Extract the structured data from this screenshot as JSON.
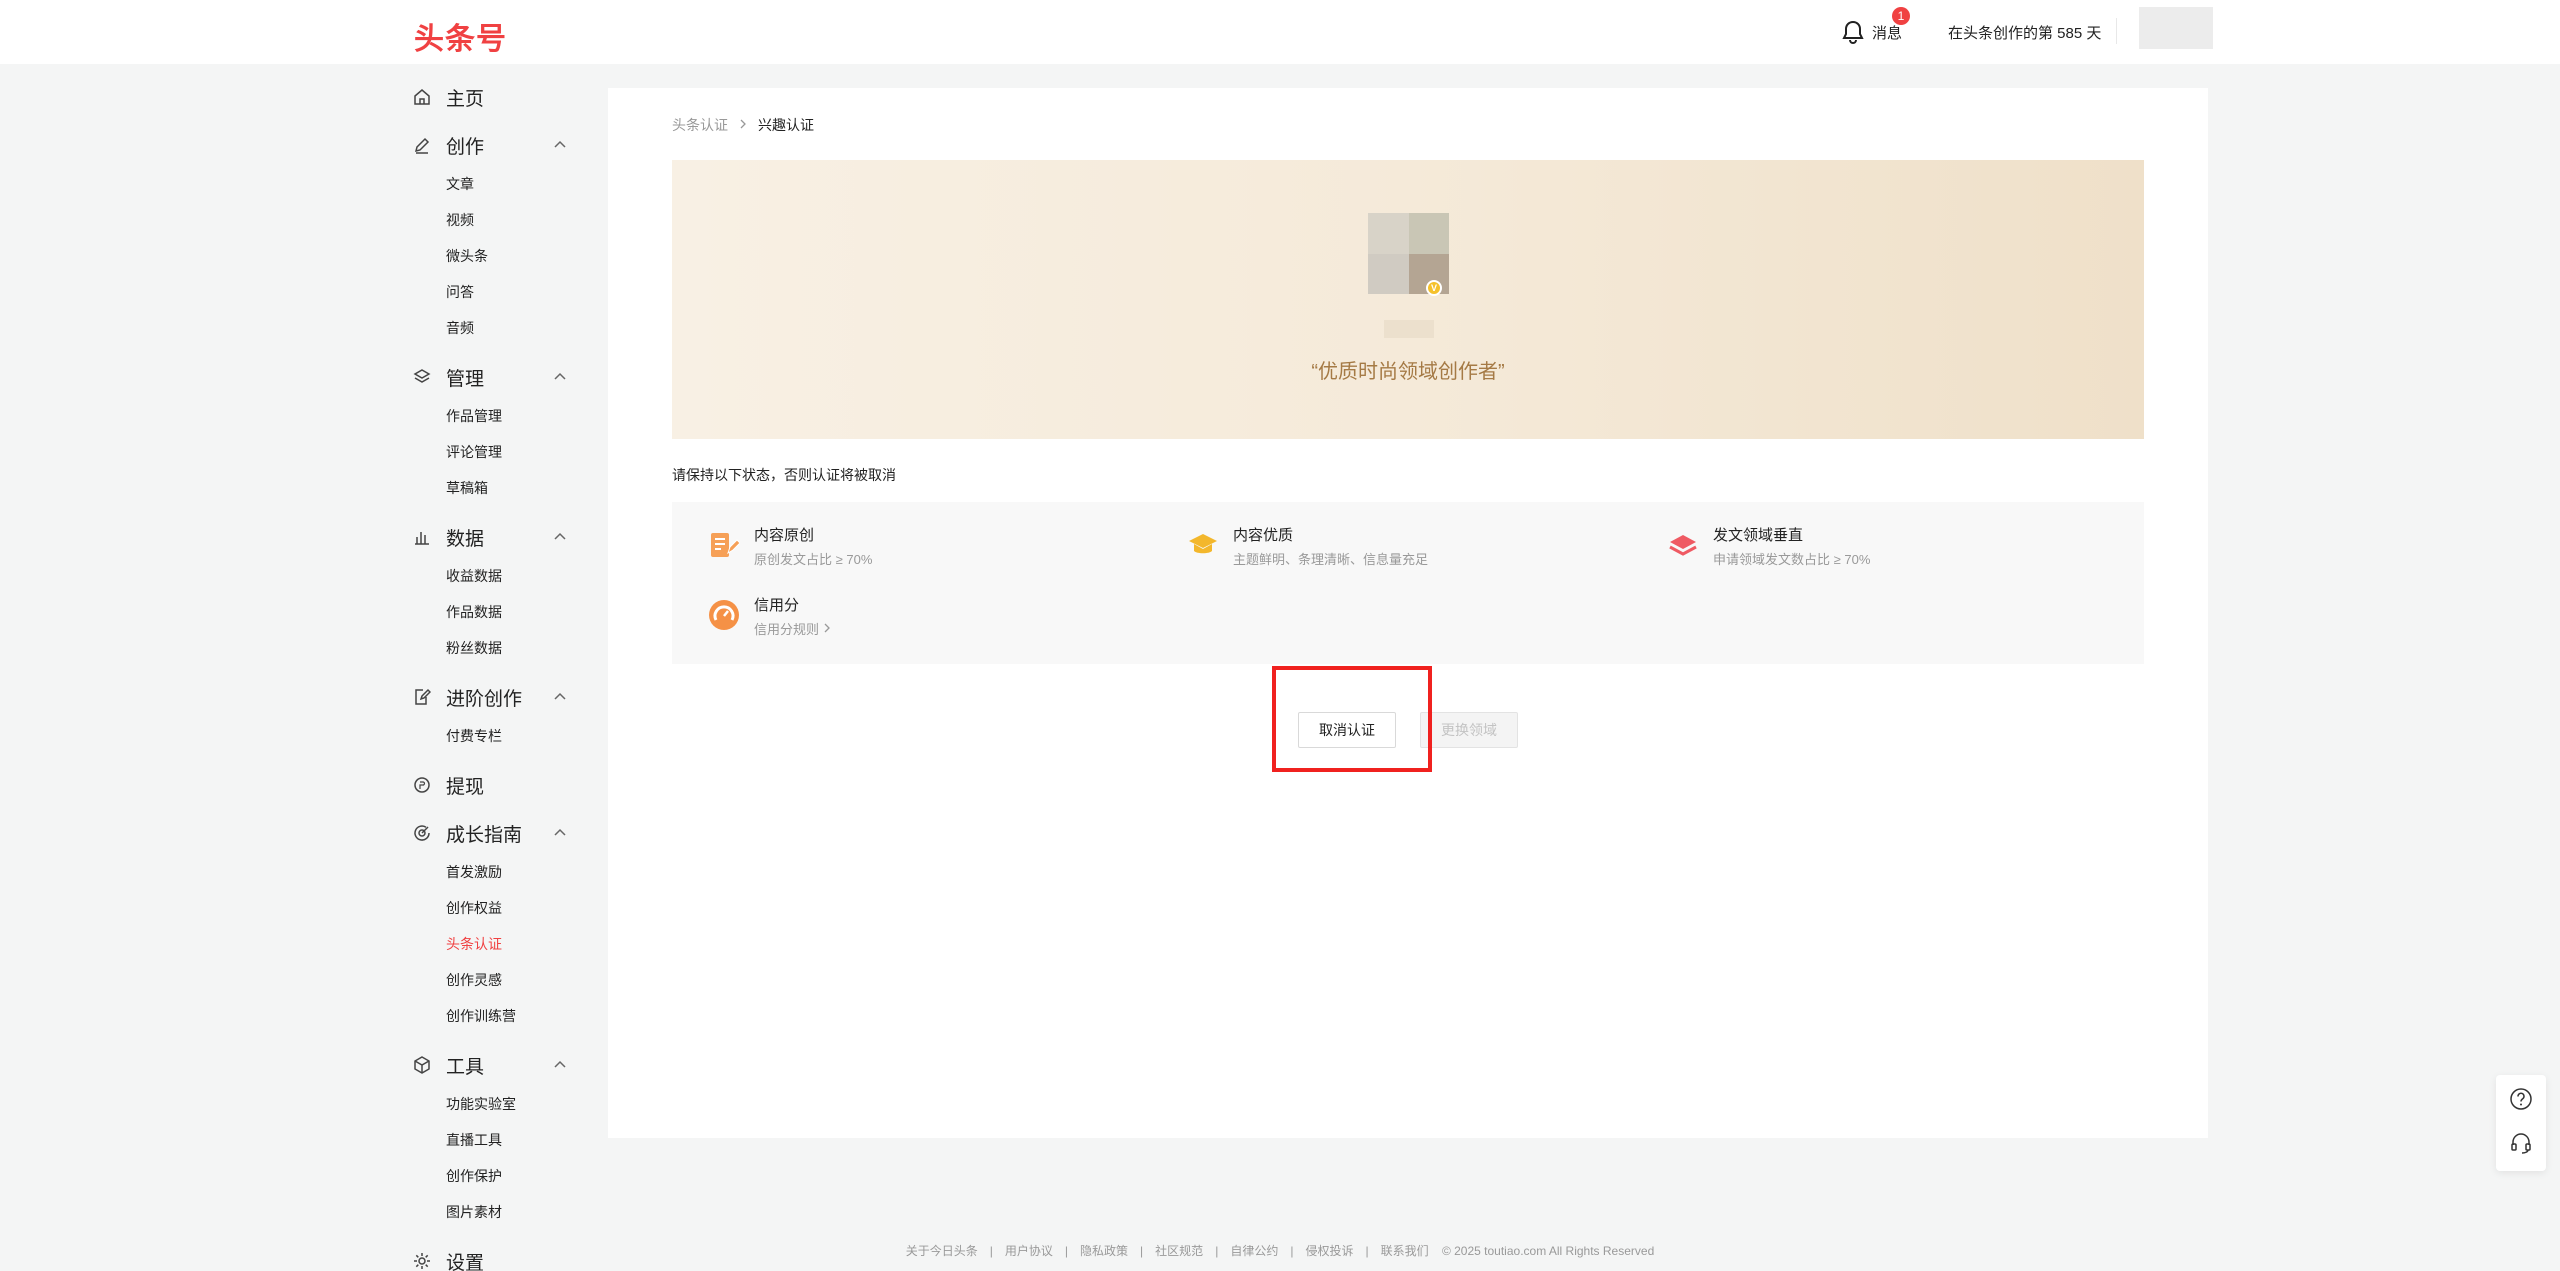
{
  "header": {
    "logo": "头条号",
    "messages_label": "消息",
    "messages_badge": "1",
    "days_text": "在头条创作的第 585 天"
  },
  "sidebar": {
    "groups": [
      {
        "label": "主页",
        "icon": "home-icon",
        "items": []
      },
      {
        "label": "创作",
        "icon": "pen-icon",
        "items": [
          "文章",
          "视频",
          "微头条",
          "问答",
          "音频"
        ]
      },
      {
        "label": "管理",
        "icon": "layers-icon",
        "items": [
          "作品管理",
          "评论管理",
          "草稿箱"
        ]
      },
      {
        "label": "数据",
        "icon": "bar-chart-icon",
        "items": [
          "收益数据",
          "作品数据",
          "粉丝数据"
        ]
      },
      {
        "label": "进阶创作",
        "icon": "edit-doc-icon",
        "items": [
          "付费专栏"
        ]
      },
      {
        "label": "提现",
        "icon": "coin-icon",
        "items": []
      },
      {
        "label": "成长指南",
        "icon": "growth-icon",
        "items": [
          "首发激励",
          "创作权益",
          "头条认证",
          "创作灵感",
          "创作训练营"
        ]
      },
      {
        "label": "工具",
        "icon": "cube-icon",
        "items": [
          "功能实验室",
          "直播工具",
          "创作保护",
          "图片素材"
        ]
      },
      {
        "label": "设置",
        "icon": "gear-icon",
        "items": []
      }
    ],
    "active_item": "头条认证"
  },
  "breadcrumb": {
    "parent": "头条认证",
    "current": "兴趣认证"
  },
  "banner": {
    "title": "“优质时尚领域创作者”"
  },
  "notice": "请保持以下状态，否则认证将被取消",
  "requirements": [
    {
      "title": "内容原创",
      "desc": "原创发文占比 ≥ 70%",
      "icon": "original-doc-icon",
      "color": "#f6a057"
    },
    {
      "title": "内容优质",
      "desc": "主题鲜明、条理清晰、信息量充足",
      "icon": "graduation-cap-icon",
      "color": "#f3b72c"
    },
    {
      "title": "发文领域垂直",
      "desc": "申请领域发文数占比 ≥ 70%",
      "icon": "stack-icon",
      "color": "#ef5a63"
    },
    {
      "title": "信用分",
      "desc": "信用分规则",
      "icon": "gauge-icon",
      "color": "#f59146"
    }
  ],
  "buttons": {
    "cancel": "取消认证",
    "change": "更换领域"
  },
  "footer": {
    "links": [
      "关于今日头条",
      "用户协议",
      "隐私政策",
      "社区规范",
      "自律公约",
      "侵权投诉",
      "联系我们"
    ],
    "copyright": "© 2025 toutiao.com All Rights Reserved"
  }
}
